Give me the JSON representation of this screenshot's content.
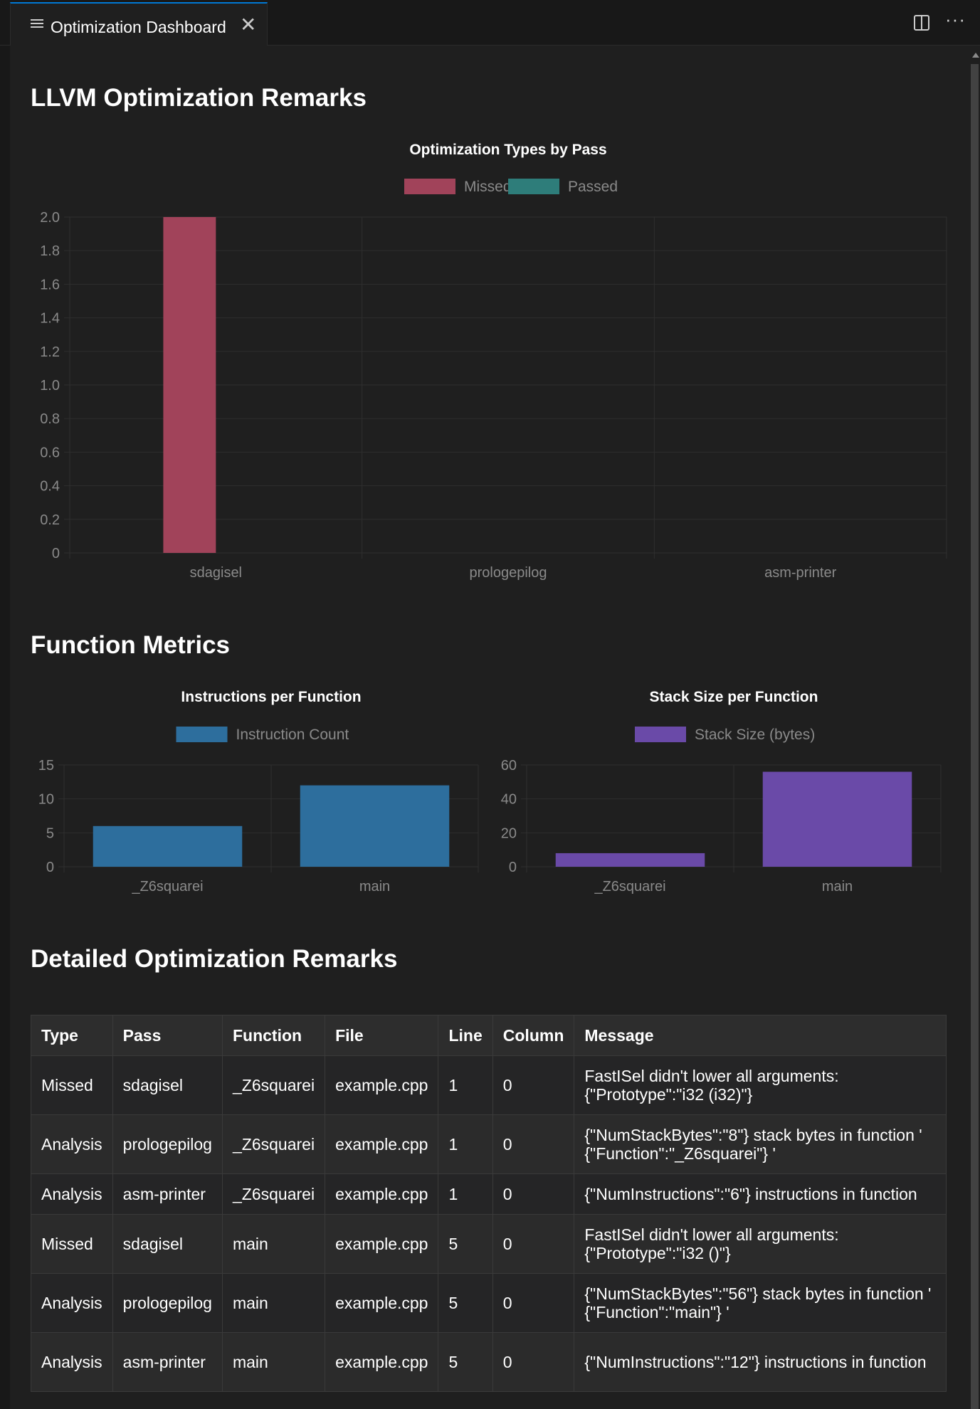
{
  "tab": {
    "title": "Optimization Dashboard",
    "icon": "list-lines-icon"
  },
  "headings": {
    "main": "LLVM Optimization Remarks",
    "metrics": "Function Metrics",
    "detail": "Detailed Optimization Remarks"
  },
  "colors": {
    "missed": "#a1435a",
    "passed": "#2e7d7a",
    "instructions": "#2d6e9d",
    "stack": "#6a4aa8"
  },
  "chart_data": [
    {
      "type": "bar",
      "title": "Optimization Types by Pass",
      "categories": [
        "sdagisel",
        "prologepilog",
        "asm-printer"
      ],
      "series": [
        {
          "name": "Missed",
          "values": [
            2,
            0,
            0
          ],
          "color": "#a1435a"
        },
        {
          "name": "Passed",
          "values": [
            0,
            0,
            0
          ],
          "color": "#2e7d7a"
        }
      ],
      "ylim": [
        0,
        2.0
      ],
      "yticks": [
        "0",
        "0.2",
        "0.4",
        "0.6",
        "0.8",
        "1.0",
        "1.2",
        "1.4",
        "1.6",
        "1.8",
        "2.0"
      ],
      "legend": "top",
      "grid": true
    },
    {
      "type": "bar",
      "title": "Instructions per Function",
      "categories": [
        "_Z6squarei",
        "main"
      ],
      "series": [
        {
          "name": "Instruction Count",
          "values": [
            6,
            12
          ],
          "color": "#2d6e9d"
        }
      ],
      "ylim": [
        0,
        15
      ],
      "yticks": [
        "0",
        "5",
        "10",
        "15"
      ],
      "legend": "top",
      "grid": true
    },
    {
      "type": "bar",
      "title": "Stack Size per Function",
      "categories": [
        "_Z6squarei",
        "main"
      ],
      "series": [
        {
          "name": "Stack Size (bytes)",
          "values": [
            8,
            56
          ],
          "color": "#6a4aa8"
        }
      ],
      "ylim": [
        0,
        60
      ],
      "yticks": [
        "0",
        "20",
        "40",
        "60"
      ],
      "legend": "top",
      "grid": true
    }
  ],
  "table": {
    "headers": [
      "Type",
      "Pass",
      "Function",
      "File",
      "Line",
      "Column",
      "Message"
    ],
    "rows": [
      [
        "Missed",
        "sdagisel",
        "_Z6squarei",
        "example.cpp",
        "1",
        "0",
        "FastISel didn't lower all arguments: {\"Prototype\":\"i32 (i32)\"}"
      ],
      [
        "Analysis",
        "prologepilog",
        "_Z6squarei",
        "example.cpp",
        "1",
        "0",
        "{\"NumStackBytes\":\"8\"} stack bytes in function ' {\"Function\":\"_Z6squarei\"} '"
      ],
      [
        "Analysis",
        "asm-printer",
        "_Z6squarei",
        "example.cpp",
        "1",
        "0",
        "{\"NumInstructions\":\"6\"} instructions in function"
      ],
      [
        "Missed",
        "sdagisel",
        "main",
        "example.cpp",
        "5",
        "0",
        "FastISel didn't lower all arguments: {\"Prototype\":\"i32 ()\"}"
      ],
      [
        "Analysis",
        "prologepilog",
        "main",
        "example.cpp",
        "5",
        "0",
        "{\"NumStackBytes\":\"56\"} stack bytes in function ' {\"Function\":\"main\"} '"
      ],
      [
        "Analysis",
        "asm-printer",
        "main",
        "example.cpp",
        "5",
        "0",
        "{\"NumInstructions\":\"12\"} instructions in function"
      ]
    ]
  }
}
